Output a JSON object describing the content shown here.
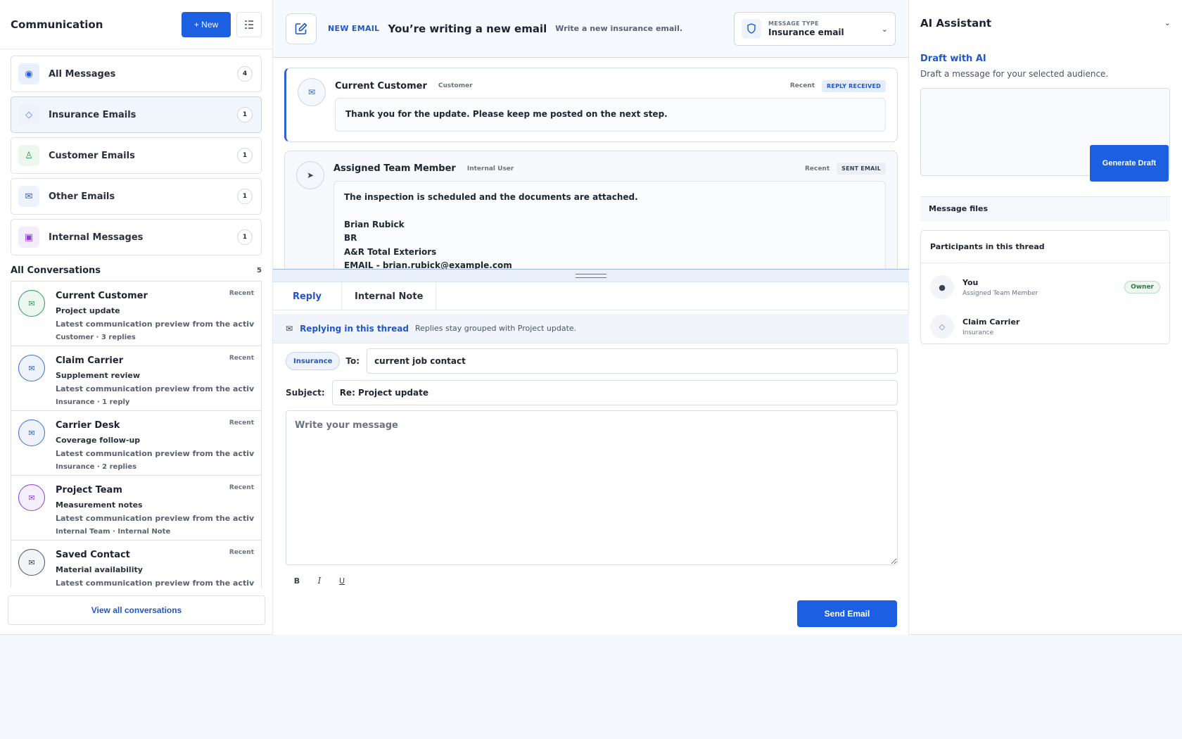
{
  "left": {
    "title": "Communication",
    "new_label": "+ New",
    "folders": [
      {
        "label": "All Messages",
        "count": "4",
        "icon": "◉",
        "color": "#1c5fe0",
        "bg": "#eaf0fb"
      },
      {
        "label": "Insurance Emails",
        "count": "1",
        "icon": "◇",
        "color": "#4f86e6",
        "bg": "#eef3fb"
      },
      {
        "label": "Customer Emails",
        "count": "1",
        "icon": "♙",
        "color": "#2d9a58",
        "bg": "#ecf7f0"
      },
      {
        "label": "Other Emails",
        "count": "1",
        "icon": "✉",
        "color": "#2c63d4",
        "bg": "#edf2fb"
      },
      {
        "label": "Internal Messages",
        "count": "1",
        "icon": "▣",
        "color": "#8a3fd6",
        "bg": "#f3ecfb"
      }
    ],
    "conversations_title": "All Conversations",
    "conversations_count": "5",
    "conversations": [
      {
        "name": "Current Customer",
        "subject": "Project update",
        "preview": "Latest communication preview from the active claim.",
        "meta": "Customer · 3 replies",
        "time": "Recent",
        "border": "#2d9a58",
        "color": "#2d9a58",
        "bg": "#ecf7f0"
      },
      {
        "name": "Claim Carrier",
        "subject": "Supplement review",
        "preview": "Latest communication preview from the active claim.",
        "meta": "Insurance · 1 reply",
        "time": "Recent",
        "border": "#3a6fd0",
        "color": "#2c63d4",
        "bg": "#edf2fb"
      },
      {
        "name": "Carrier Desk",
        "subject": "Coverage follow-up",
        "preview": "Latest communication preview from the active claim.",
        "meta": "Insurance · 2 replies",
        "time": "Recent",
        "border": "#3a6fd0",
        "color": "#2c63d4",
        "bg": "#edf2fb"
      },
      {
        "name": "Project Team",
        "subject": "Measurement notes",
        "preview": "Latest communication preview from the active claim.",
        "meta": "Internal Team · Internal Note",
        "time": "Recent",
        "border": "#8a3fd6",
        "color": "#8a3fd6",
        "bg": "#f5eefc"
      },
      {
        "name": "Saved Contact",
        "subject": "Material availability",
        "preview": "Latest communication preview from the active claim.",
        "meta": "",
        "time": "Recent",
        "border": "#4a5262",
        "color": "#3b4150",
        "bg": "#f2f4f8"
      }
    ],
    "view_all": "View all conversations"
  },
  "header": {
    "label": "NEW EMAIL",
    "title": "You’re writing a new email",
    "subtitle": "Write a new insurance email.",
    "message_type_label": "MESSAGE TYPE",
    "message_type_value": "Insurance email"
  },
  "thread": [
    {
      "name": "Current Customer",
      "role": "Customer",
      "time": "Recent",
      "tag": "REPLY RECEIVED",
      "text": "Thank you for the update. Please keep me posted on the next step."
    },
    {
      "name": "Assigned Team Member",
      "role": "Internal User",
      "time": "Recent",
      "tag": "SENT EMAIL",
      "lines": [
        "The inspection is scheduled and the documents are attached.",
        "",
        "Brian Rubick",
        "BR",
        "A&R Total Exteriors",
        "EMAIL - brian.rubick@example.com"
      ]
    }
  ],
  "compose": {
    "tab_reply": "Reply",
    "tab_note": "Internal Note",
    "replying_label": "Replying in this thread",
    "replying_sub": "Replies stay grouped with Project update.",
    "chip": "Insurance",
    "to_label": "To:",
    "to_value": "current job contact",
    "subject_label": "Subject:",
    "subject_value": "Re: Project update",
    "body_placeholder": "Write your message",
    "bold": "B",
    "italic": "I",
    "underline": "U",
    "send": "Send Email"
  },
  "ai": {
    "title": "AI Assistant",
    "draft_title": "Draft with AI",
    "draft_sub": "Draft a message for your selected audience.",
    "generate": "Generate Draft",
    "files": "Message files",
    "participants_title": "Participants in this thread",
    "participants": [
      {
        "name": "You",
        "role": "Assigned Team Member",
        "badge": "Owner",
        "icon": "●"
      },
      {
        "name": "Claim Carrier",
        "role": "Insurance",
        "badge": "",
        "icon": "◇"
      }
    ]
  }
}
